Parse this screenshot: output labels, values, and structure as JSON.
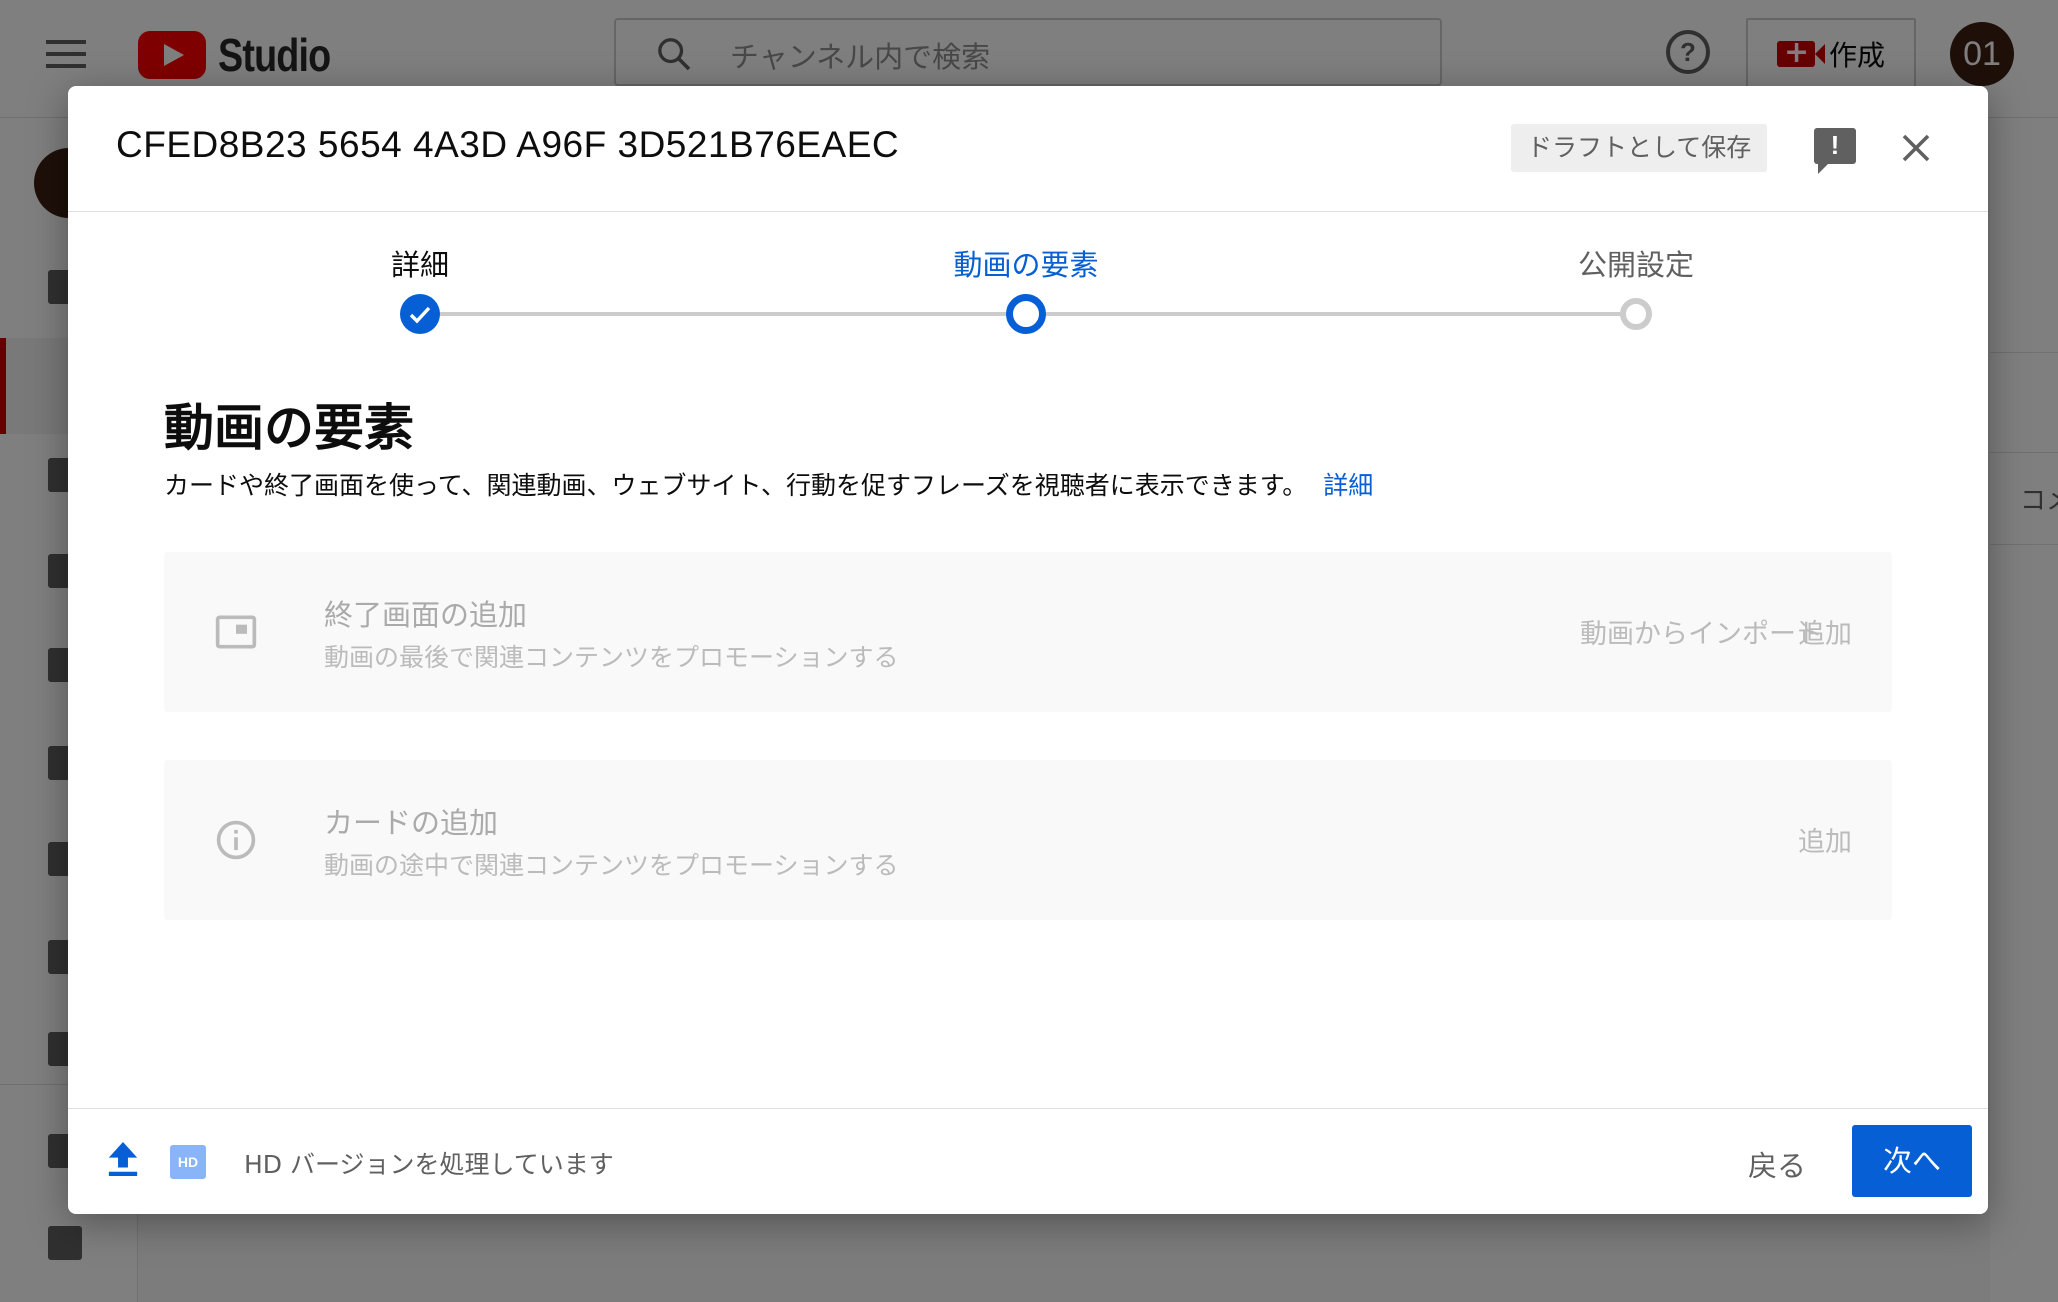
{
  "app": {
    "logo_text": "Studio",
    "search_placeholder": "チャンネル内で検索",
    "create_label": "作成",
    "avatar_text": "01",
    "right_panel_text": "コメ"
  },
  "dialog": {
    "title": "CFED8B23 5654 4A3D A96F 3D521B76EAEC",
    "save_draft_label": "ドラフトとして保存",
    "steps": [
      {
        "label": "詳細",
        "state": "done"
      },
      {
        "label": "動画の要素",
        "state": "current"
      },
      {
        "label": "公開設定",
        "state": "todo"
      }
    ],
    "section": {
      "title": "動画の要素",
      "description": "カードや終了画面を使って、関連動画、ウェブサイト、行動を促すフレーズを視聴者に表示できます。",
      "link": "詳細"
    },
    "cards": [
      {
        "icon": "end-screen-icon",
        "title": "終了画面の追加",
        "subtitle": "動画の最後で関連コンテンツをプロモーションする",
        "import_label": "動画からインポート",
        "add_label": "追加"
      },
      {
        "icon": "info-icon",
        "title": "カードの追加",
        "subtitle": "動画の途中で関連コンテンツをプロモーションする",
        "add_label": "追加"
      }
    ],
    "footer": {
      "hd_badge": "HD",
      "status": "HD バージョンを処理しています",
      "back_label": "戻る",
      "next_label": "次へ"
    }
  },
  "colors": {
    "accent": "#065fd4",
    "brand_red": "#ff0000",
    "disabled_text": "#aaaaaa"
  }
}
